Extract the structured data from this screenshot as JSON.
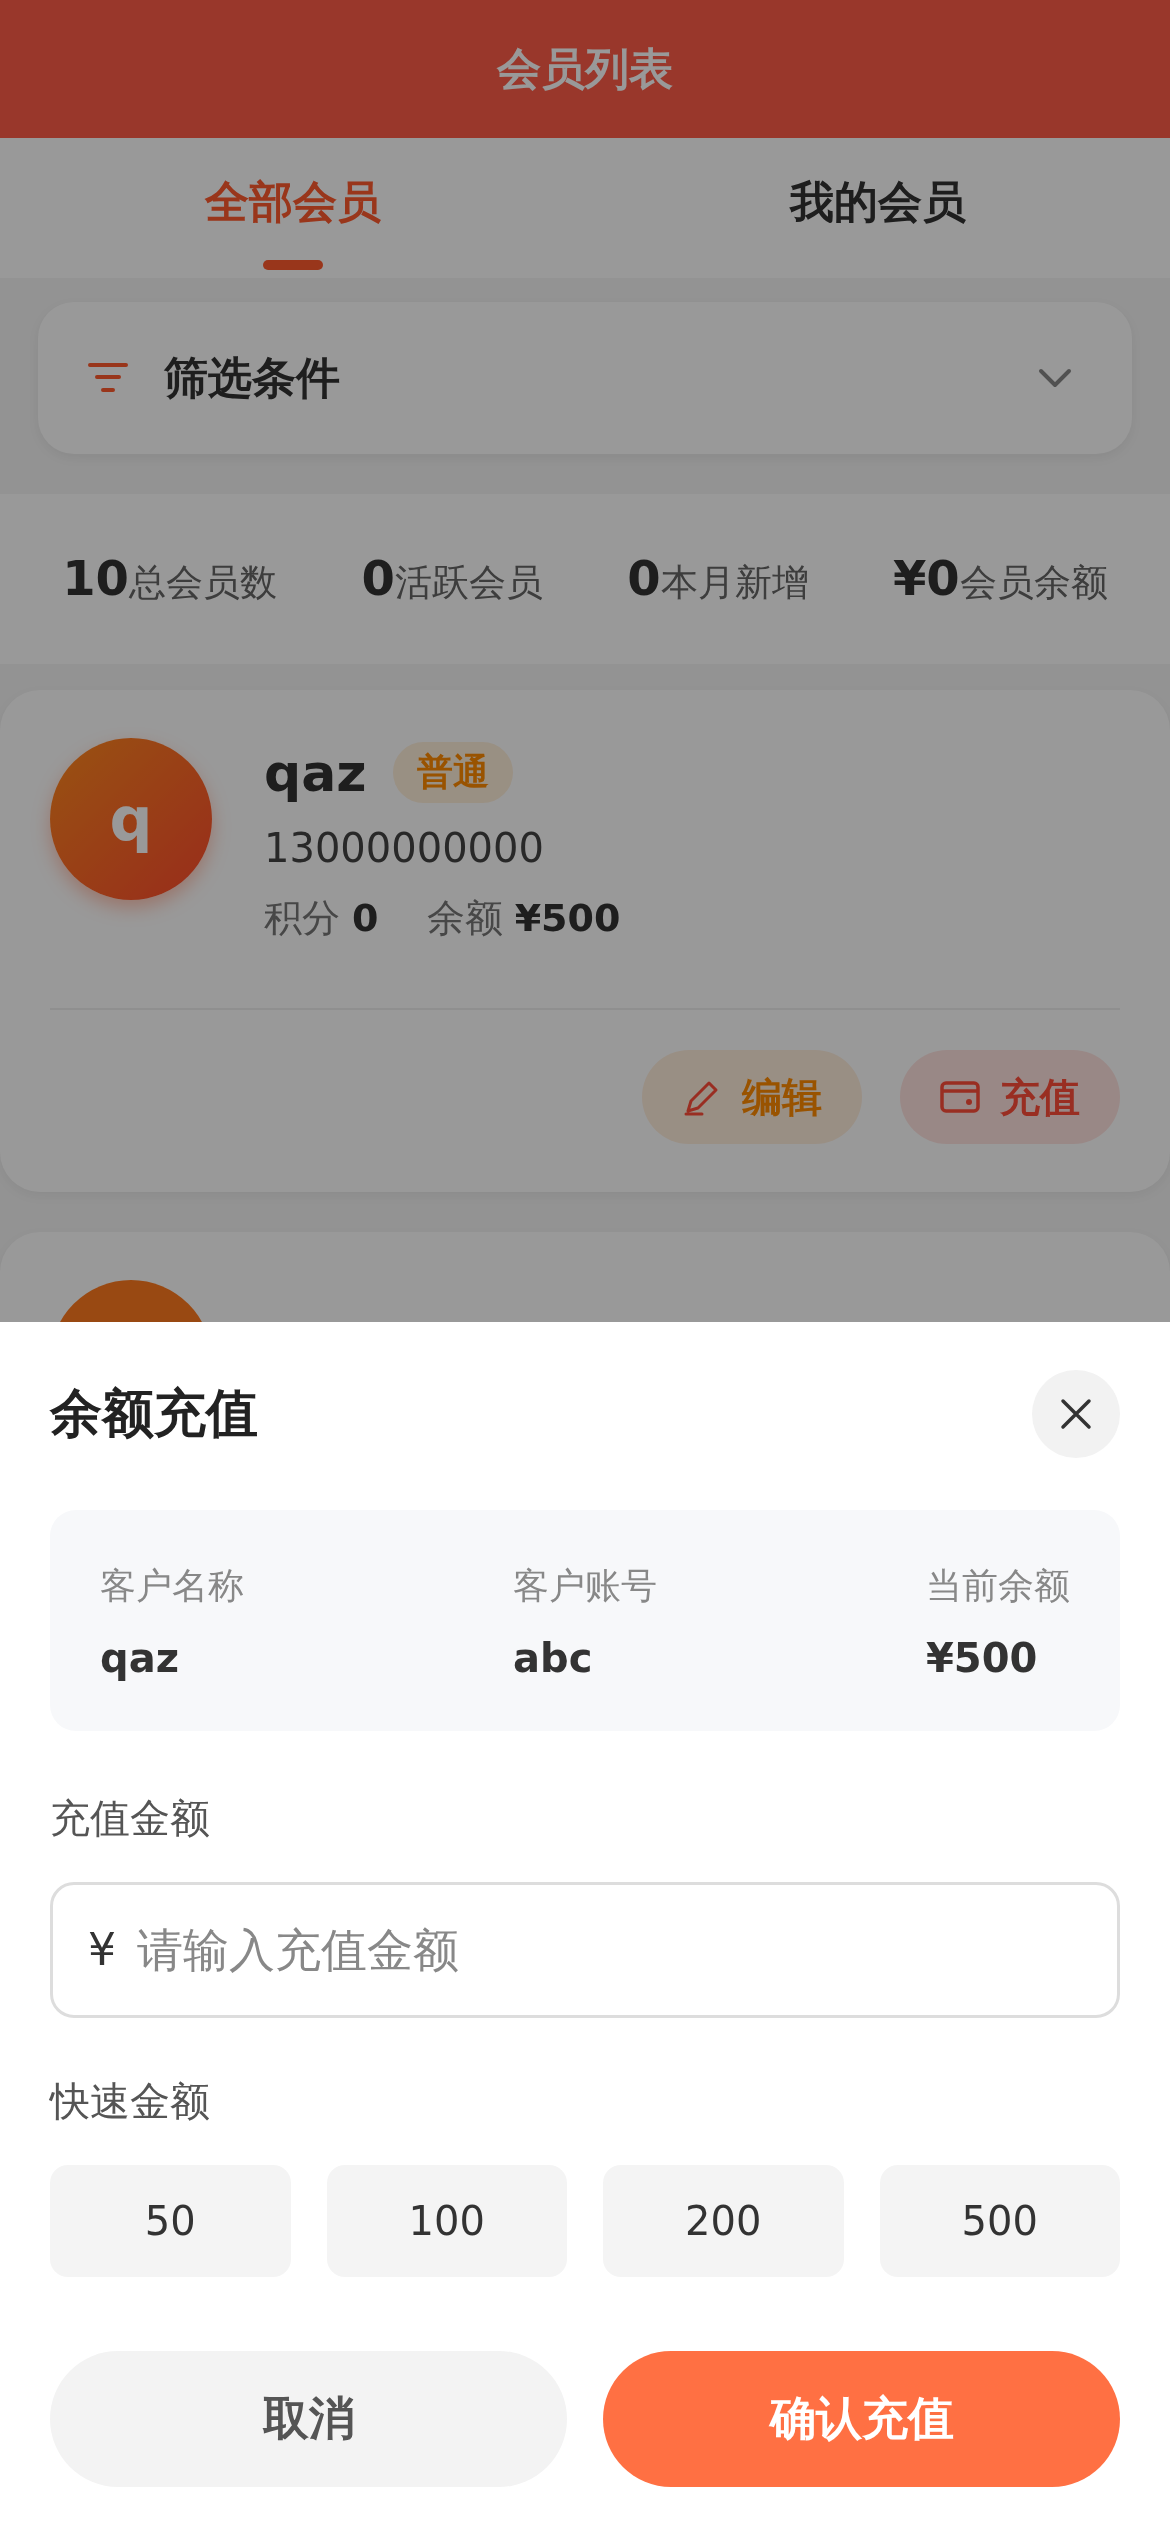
{
  "header": {
    "title": "会员列表"
  },
  "tabs": [
    {
      "label": "全部会员",
      "selected": true
    },
    {
      "label": "我的会员",
      "selected": false
    }
  ],
  "filter": {
    "label": "筛选条件",
    "expanded": false
  },
  "stats": [
    {
      "value": "10",
      "label": "总会员数"
    },
    {
      "value": "0",
      "label": "活跃会员"
    },
    {
      "value": "0",
      "label": "本月新增"
    },
    {
      "value": "¥0",
      "label": "会员余额"
    }
  ],
  "members": [
    {
      "kind": "full",
      "initial": "q",
      "name": "qaz",
      "tag": "普通",
      "phone": "13000000000",
      "points_label": "积分",
      "points": "0",
      "balance_label": "余额",
      "balance": "¥500",
      "actions": [
        {
          "kind": "edit",
          "label": "编辑"
        },
        {
          "kind": "recharge",
          "label": "充值"
        }
      ]
    },
    {
      "kind": "peek"
    }
  ],
  "recharge_sheet": {
    "title": "余额充值",
    "info": [
      {
        "label": "客户名称",
        "value": "qaz"
      },
      {
        "label": "客户账号",
        "value": "abc"
      },
      {
        "label": "当前余额",
        "value": "¥500"
      }
    ],
    "amount_label": "充值金额",
    "currency": "¥",
    "placeholder": "请输入充值金额",
    "quick_label": "快速金额",
    "quick_amounts": [
      "50",
      "100",
      "200",
      "500"
    ],
    "cancel": "取消",
    "confirm": "确认充值"
  }
}
